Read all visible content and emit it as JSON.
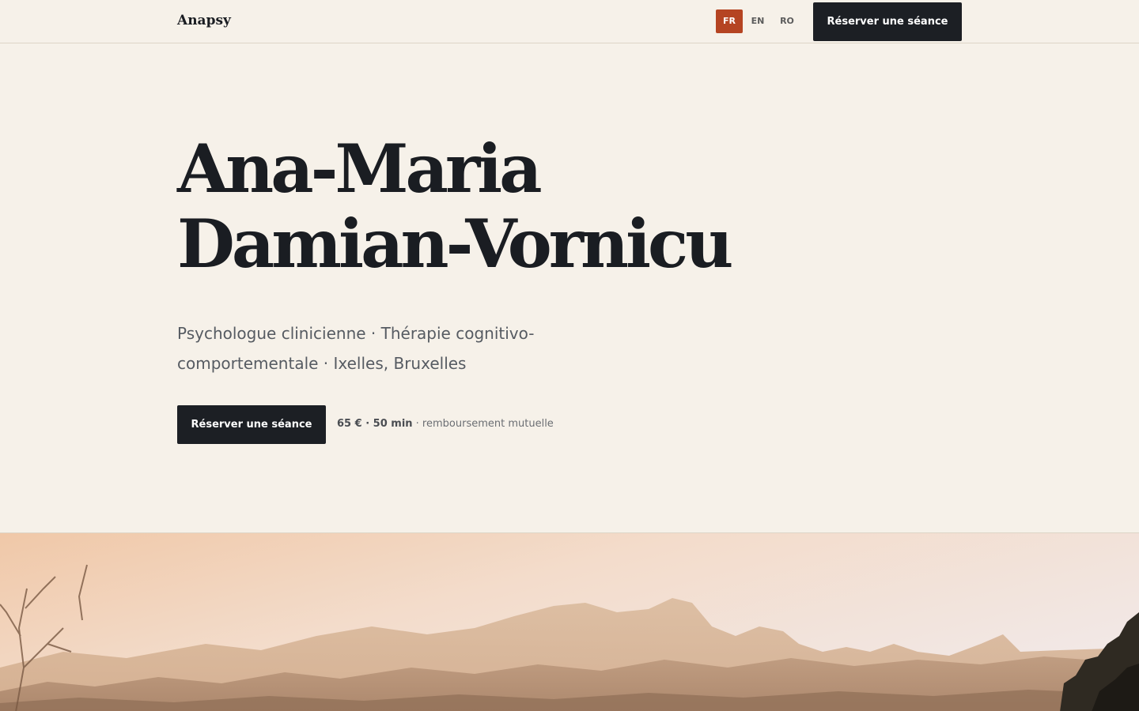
{
  "header": {
    "brand": "Anapsy",
    "languages": [
      {
        "code": "FR",
        "active": true
      },
      {
        "code": "EN",
        "active": false
      },
      {
        "code": "RO",
        "active": false
      }
    ],
    "cta_label": "Réserver une séance"
  },
  "hero": {
    "name_line1": "Ana-Maria",
    "name_line2": "Damian-Vornicu",
    "subtitle": "Psychologue clinicienne · Thérapie cognitivo-comportementale · Ixelles, Bruxelles",
    "cta_label": "Réserver une séance",
    "price": "65 € · 50 min",
    "price_note": " · remboursement mutuelle"
  },
  "colors": {
    "background": "#f6f1e9",
    "accent": "#b54422",
    "dark": "#1c1f24",
    "text": "#1a1d22",
    "muted": "#565b62"
  },
  "image": {
    "subject": "mountain-landscape-photo"
  }
}
